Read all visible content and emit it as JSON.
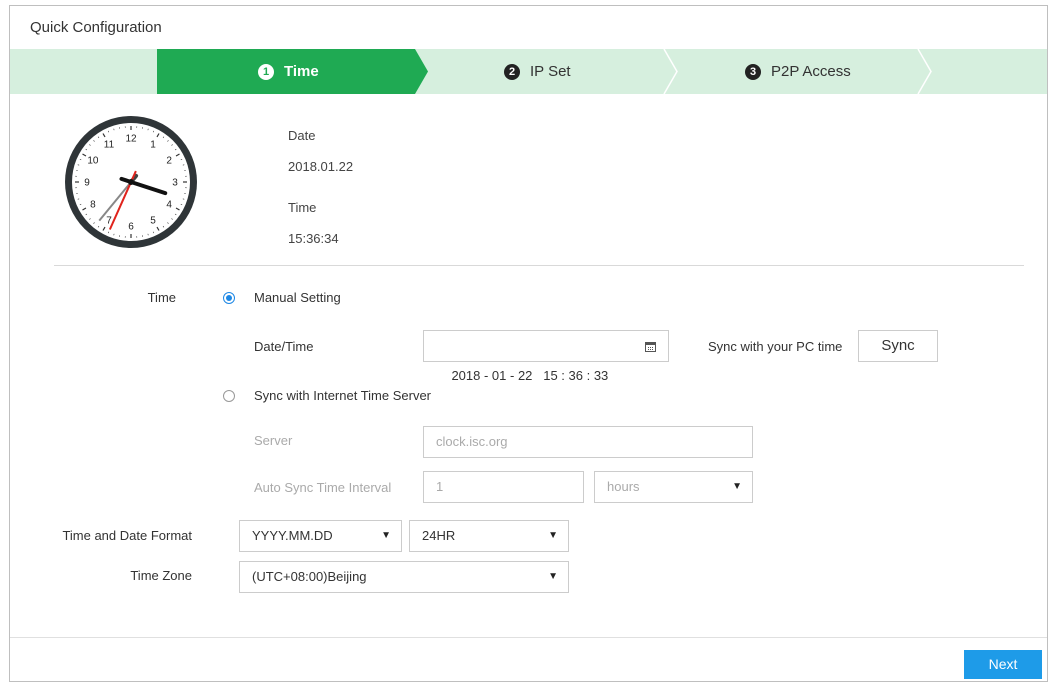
{
  "dialog": {
    "title": "Quick Configuration"
  },
  "steps": [
    {
      "num": "1",
      "label": "Time",
      "active": true
    },
    {
      "num": "2",
      "label": "IP Set",
      "active": false
    },
    {
      "num": "3",
      "label": "P2P Access",
      "active": false
    }
  ],
  "colors": {
    "step_active": "#1faa53",
    "step_inactive": "#d6efde",
    "accent": "#1e9be8",
    "clock_second_hand": "#e0231c"
  },
  "current": {
    "date_label": "Date",
    "date_value": "2018.01.22",
    "time_label": "Time",
    "time_value": "15:36:34"
  },
  "form": {
    "time_label": "Time",
    "manual_setting_label": "Manual Setting",
    "manual_selected": true,
    "datetime_label": "Date/Time",
    "datetime_value": "2018 - 01 - 22   15 : 36 : 33",
    "sync_pc_label": "Sync with your PC time",
    "sync_button": "Sync",
    "ntp_label": "Sync with Internet Time Server",
    "ntp_selected": false,
    "server_label": "Server",
    "server_value": "clock.isc.org",
    "interval_label": "Auto Sync Time Interval",
    "interval_value": "1",
    "interval_unit": "hours",
    "format_label": "Time and Date Format",
    "date_format": "YYYY.MM.DD",
    "time_format": "24HR",
    "timezone_label": "Time Zone",
    "timezone_value": "(UTC+08:00)Beijing"
  },
  "clock": {
    "numbers": [
      "12",
      "1",
      "2",
      "3",
      "4",
      "5",
      "6",
      "7",
      "8",
      "9",
      "10",
      "11"
    ],
    "time": "15:36:34"
  },
  "footer": {
    "next_button": "Next"
  }
}
